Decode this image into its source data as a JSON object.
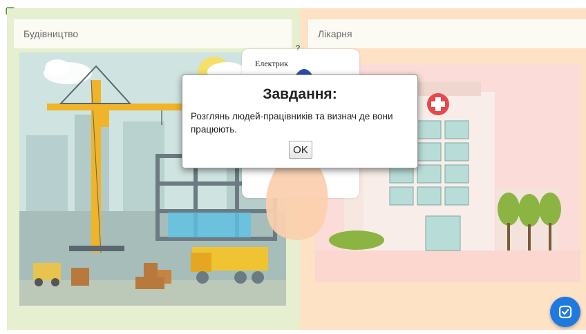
{
  "categories": [
    {
      "label": "Будівництво",
      "scene": "construction-site"
    },
    {
      "label": "Лікарня",
      "scene": "hospital"
    }
  ],
  "card": {
    "question_mark": "?",
    "label": "Електрик"
  },
  "modal": {
    "title": "Завдання:",
    "message": "Розглянь людей-працівників та визнач де вони працюють.",
    "ok_label": "OK"
  },
  "icons": {
    "help": "help-question-icon",
    "check": "check-submit-icon"
  },
  "colors": {
    "left_panel": "#e6efcf",
    "right_panel": "#fde2c6",
    "check_button": "#1f7ae0"
  }
}
